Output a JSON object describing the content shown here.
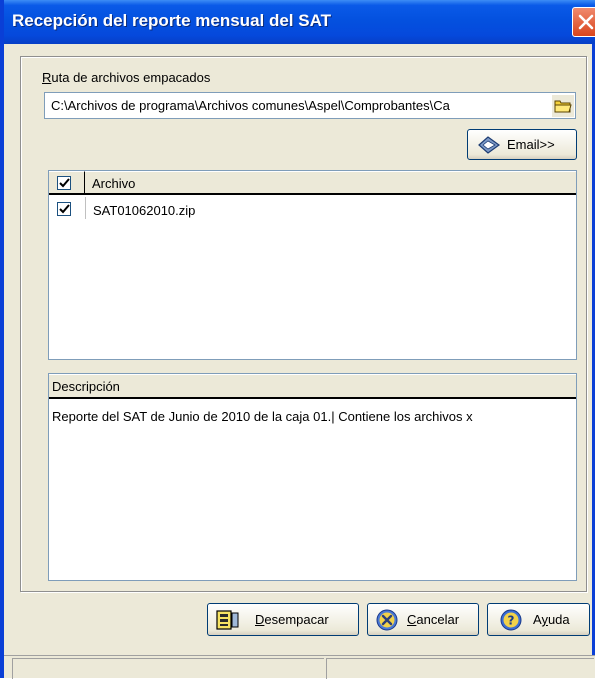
{
  "window": {
    "title": "Recepción del reporte mensual del SAT"
  },
  "ruta": {
    "label": "Ruta de archivos empacados",
    "value": "C:\\Archivos de programa\\Archivos comunes\\Aspel\\Comprobantes\\Ca"
  },
  "email_button": {
    "label": "Email>>"
  },
  "files": {
    "header": "Archivo",
    "header_checked": true,
    "rows": [
      {
        "name": "SAT01062010.zip",
        "checked": true
      }
    ]
  },
  "description": {
    "header": "Descripción",
    "text": "Reporte del SAT de Junio de 2010 de la caja 01.| Contiene los archivos x"
  },
  "buttons": {
    "desempacar": "Desempacar",
    "cancelar": "Cancelar",
    "ayuda": "Ayuda"
  },
  "colors": {
    "titlebar": "#0451df",
    "face": "#ece9d8",
    "close": "#d9451d"
  }
}
